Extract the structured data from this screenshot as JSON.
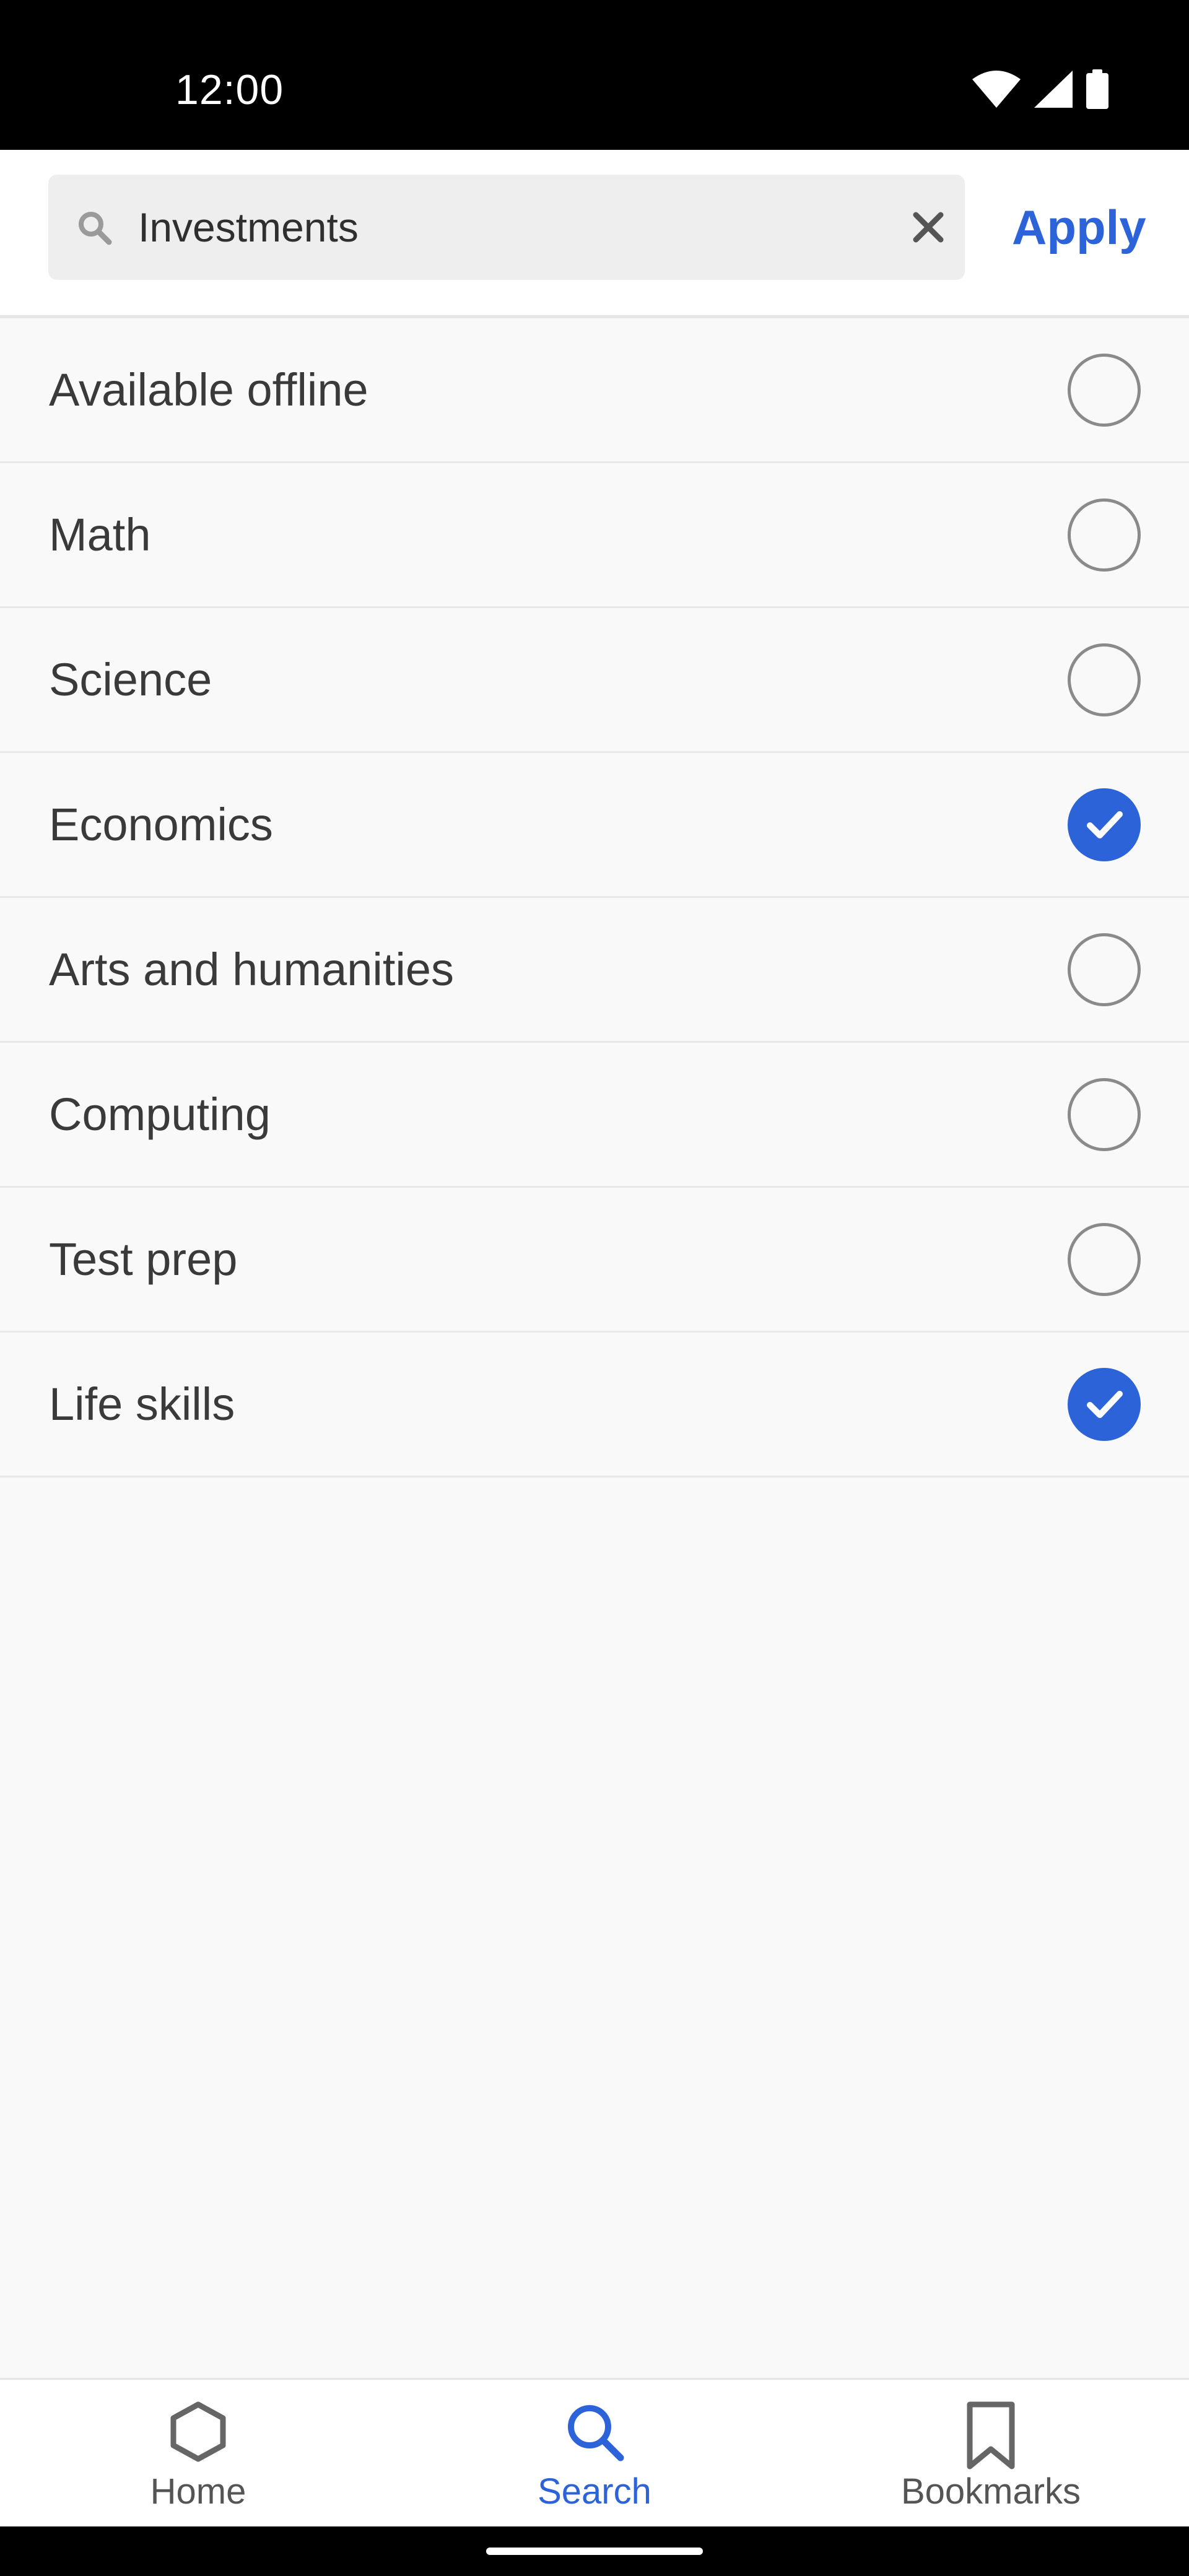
{
  "status_bar": {
    "time": "12:00",
    "icons": [
      "wifi-icon",
      "signal-icon",
      "battery-icon"
    ]
  },
  "search": {
    "value": "Investments",
    "apply_label": "Apply"
  },
  "filters": [
    {
      "label": "Available offline",
      "checked": false
    },
    {
      "label": "Math",
      "checked": false
    },
    {
      "label": "Science",
      "checked": false
    },
    {
      "label": "Economics",
      "checked": true
    },
    {
      "label": "Arts and humanities",
      "checked": false
    },
    {
      "label": "Computing",
      "checked": false
    },
    {
      "label": "Test prep",
      "checked": false
    },
    {
      "label": "Life skills",
      "checked": true
    }
  ],
  "bottom_nav": {
    "items": [
      {
        "label": "Home",
        "icon": "hexagon-icon",
        "active": false
      },
      {
        "label": "Search",
        "icon": "search-icon",
        "active": true
      },
      {
        "label": "Bookmarks",
        "icon": "bookmark-icon",
        "active": false
      }
    ]
  },
  "colors": {
    "accent": "#2c63d8",
    "status_bar": "#000000",
    "background": "#f9f9f9"
  }
}
